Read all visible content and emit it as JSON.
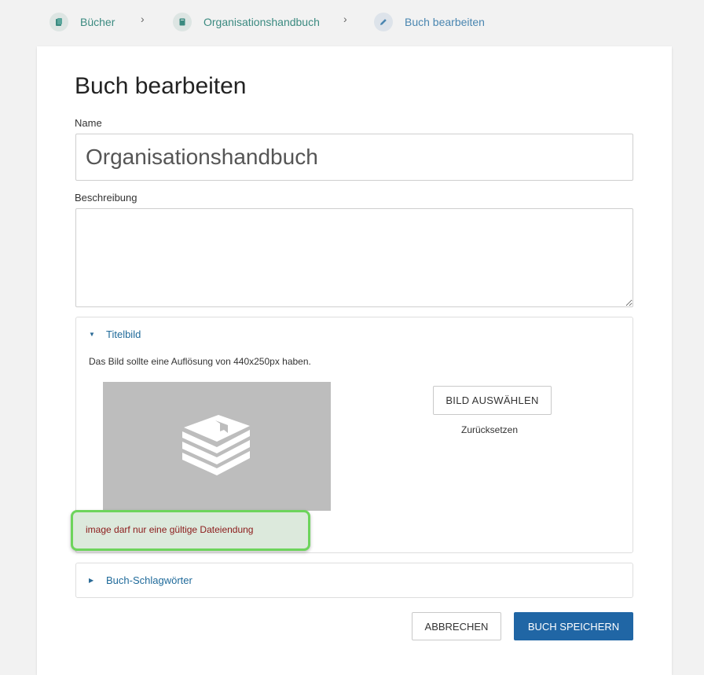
{
  "breadcrumbs": [
    {
      "label": "Bücher",
      "icon": "books-icon"
    },
    {
      "label": "Organisationshandbuch",
      "icon": "book-icon"
    },
    {
      "label": "Buch bearbeiten",
      "icon": "pencil-icon"
    }
  ],
  "breadcrumb_separator": "›",
  "page_title": "Buch bearbeiten",
  "form": {
    "name_label": "Name",
    "name_value": "Organisationshandbuch",
    "description_label": "Beschreibung",
    "description_value": ""
  },
  "cover_section": {
    "title": "Titelbild",
    "expanded": true,
    "hint": "Das Bild sollte eine Auflösung von 440x250px haben.",
    "select_button": "BILD AUSWÄHLEN",
    "reset_link": "Zurücksetzen",
    "error": "image darf nur eine gültige Dateiendung"
  },
  "tags_section": {
    "title": "Buch-Schlagwörter",
    "expanded": false
  },
  "actions": {
    "cancel": "ABBRECHEN",
    "save": "BUCH SPEICHERN"
  },
  "colors": {
    "accent": "#2066a5",
    "book_link": "#3b8a80",
    "error_text": "#8b1a1a",
    "error_highlight": "#6dd45c",
    "placeholder_bg": "#bdbdbd"
  }
}
